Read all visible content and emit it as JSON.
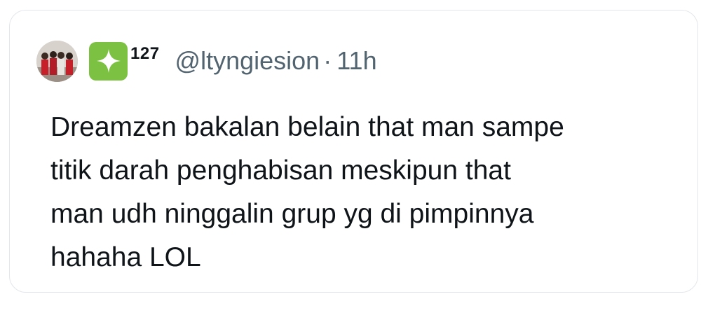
{
  "post": {
    "avatar_icon": "group-photo-avatar",
    "badge_icon": "sparkle-icon",
    "badge_color": "#7cc142",
    "badge_count": "127",
    "handle": "@ltyngiesion",
    "separator": "·",
    "time": "11h",
    "lines": [
      "Dreamzen bakalan belain that man sampe",
      "titik darah penghabisan meskipun that",
      "man udh ninggalin grup yg di pimpinnya",
      "hahaha LOL"
    ]
  }
}
